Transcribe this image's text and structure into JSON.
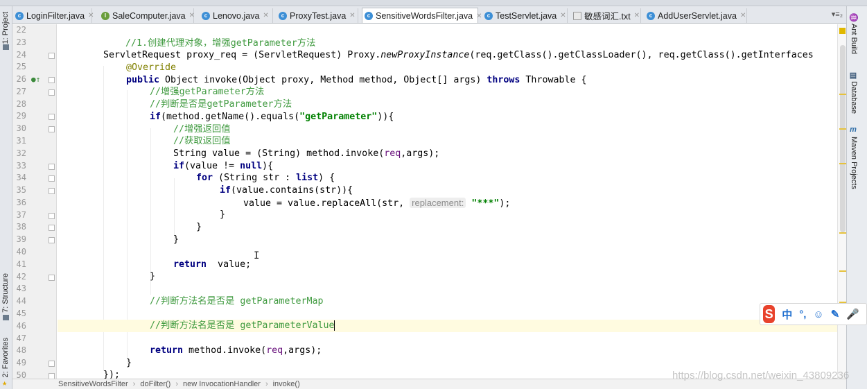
{
  "tabs": [
    {
      "label": "LoginFilter.java",
      "icon": "class-icon"
    },
    {
      "label": "SaleComputer.java",
      "icon": "interface-icon"
    },
    {
      "label": "Lenovo.java",
      "icon": "class-icon"
    },
    {
      "label": "ProxyTest.java",
      "icon": "class-icon"
    },
    {
      "label": "SensitiveWordsFilter.java",
      "icon": "class-icon",
      "active": true
    },
    {
      "label": "TestServlet.java",
      "icon": "class-icon"
    },
    {
      "label": "敏感词汇.txt",
      "icon": "text-file-icon"
    },
    {
      "label": "AddUserServlet.java",
      "icon": "class-icon"
    }
  ],
  "tab_menu": "▾≡₂",
  "left_tools": [
    "1: Project",
    "7: Structure",
    "2: Favorites"
  ],
  "right_tools": [
    "Ant Build",
    "Database",
    "Maven Projects"
  ],
  "line_numbers": [
    "22",
    "23",
    "24",
    "25",
    "26",
    "27",
    "28",
    "29",
    "30",
    "31",
    "32",
    "33",
    "34",
    "35",
    "36",
    "37",
    "38",
    "39",
    "40",
    "41",
    "42",
    "43",
    "44",
    "45",
    "46",
    "47",
    "48",
    "49",
    "50"
  ],
  "code": {
    "l22": "//1.创建代理对象，增强getParameter方法",
    "l24_a": "ServletRequest proxy_req = (ServletRequest) Proxy.",
    "l24_b": "newProxyInstance",
    "l24_c": "(req.getClass().getClassLoader(), req.getClass().getInterfaces",
    "l25": "@Override",
    "l26_kw": "public",
    "l26_a": " Object invoke(Object proxy, Method method, Object[] args) ",
    "l26_kw2": "throws",
    "l26_b": " Throwable {",
    "l27": "//增强getParameter方法",
    "l28": "//判断是否是getParameter方法",
    "l29_kw": "if",
    "l29_a": "(method.getName().equals(",
    "l29_str": "\"getParameter\"",
    "l29_b": ")){",
    "l30": "//增强返回值",
    "l31": "//获取返回值",
    "l32_a": "String value = (String) method.invoke(",
    "l32_req": "req",
    "l32_b": ",args);",
    "l33_kw": "if",
    "l33_a": "(value != ",
    "l33_kw2": "null",
    "l33_b": "){",
    "l34_kw": "for",
    "l34_a": " (String str : ",
    "l34_list": "list",
    "l34_b": ") {",
    "l35_kw": "if",
    "l35_a": "(value.contains(str)){",
    "l36_a": "value = value.replaceAll(str, ",
    "l36_hint": "replacement:",
    "l36_str": "\"***\"",
    "l36_b": ");",
    "l37": "}",
    "l38": "}",
    "l39": "}",
    "l41_kw": "return",
    "l41_a": "  value;",
    "l42": "}",
    "l44": "//判断方法名是否是 getParameterMap",
    "l46": "//判断方法名是否是 getParameterValue",
    "l48_kw": "return",
    "l48_a": " method.invoke(",
    "l48_req": "req",
    "l48_b": ",args);",
    "l49": "}",
    "l50": "});"
  },
  "breadcrumbs": [
    "SensitiveWordsFilter",
    "doFilter()",
    "new InvocationHandler",
    "invoke()"
  ],
  "watermark": "https://blog.csdn.net/weixin_43809236",
  "ime": {
    "logo": "S",
    "items": [
      "中",
      "°,",
      "☺",
      "✎",
      "🎤"
    ]
  },
  "colors": {
    "keyword": "#000080",
    "comment": "#3f9a3f",
    "string": "#008000",
    "annotation": "#808000",
    "field": "#660e7a",
    "current_line": "#fffbe0"
  }
}
